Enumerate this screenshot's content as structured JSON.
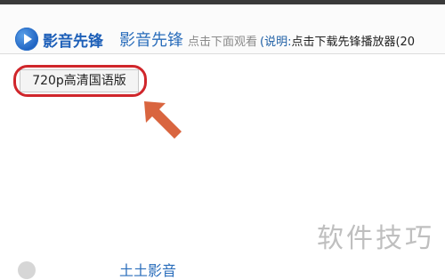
{
  "header": {
    "logo_text": "影音先锋",
    "brand_name": "影音先锋",
    "hint": "点击下面观看",
    "note_prefix": "(说明:",
    "note_link": "点击下载先锋播放器(20"
  },
  "version_button": {
    "label": "720p高清国语版"
  },
  "watermark": {
    "text": "软件技巧"
  },
  "bottom": {
    "title": "土土影音"
  },
  "colors": {
    "brand_blue": "#2a6dbb",
    "highlight_red": "#d0262b",
    "arrow_orange": "#d9653f"
  },
  "icons": {
    "logo": "play-circle-icon",
    "pointer": "arrow-up-left-icon"
  }
}
